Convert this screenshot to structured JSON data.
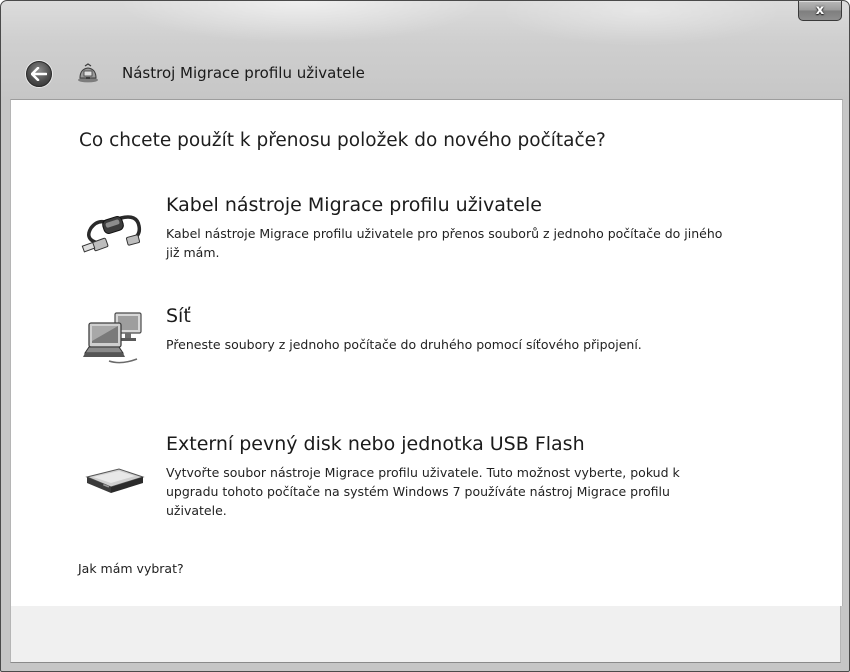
{
  "window": {
    "title": "Nástroj Migrace profilu uživatele",
    "close_label": "x"
  },
  "main": {
    "question": "Co chcete použít k přenosu položek do nového počítače?",
    "options": [
      {
        "title": "Kabel nástroje Migrace profilu uživatele",
        "description": "Kabel nástroje Migrace profilu uživatele pro přenos souborů z jednoho počítače do jiného již mám.",
        "icon": "cable-icon"
      },
      {
        "title": "Síť",
        "description": "Přeneste soubory z jednoho počítače do druhého pomocí síťového připojení.",
        "icon": "network-icon"
      },
      {
        "title": "Externí pevný disk nebo jednotka USB Flash",
        "description": "Vytvořte soubor nástroje Migrace profilu uživatele. Tuto možnost vyberte, pokud k upgradu tohoto počítače na systém Windows 7 používáte nástroj Migrace profilu uživatele.",
        "icon": "usb-drive-icon"
      }
    ],
    "help_link": "Jak mám vybrat?"
  }
}
